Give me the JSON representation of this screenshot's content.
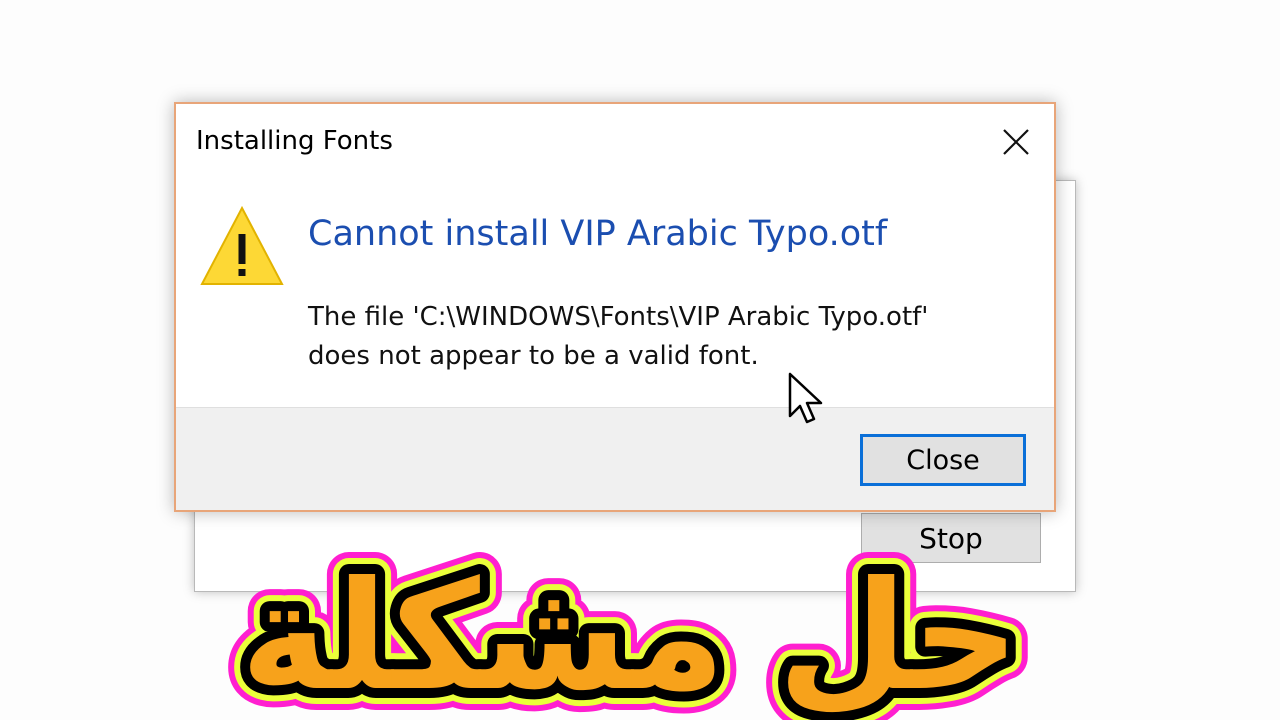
{
  "background_window": {
    "stop_label": "Stop"
  },
  "dialog": {
    "title": "Installing Fonts",
    "headline": "Cannot install VIP Arabic Typo.otf",
    "message_line1": "The file 'C:\\WINDOWS\\Fonts\\VIP Arabic Typo.otf'",
    "message_line2": "does not appear to be a valid font.",
    "close_button_label": "Close",
    "icons": {
      "warning": "warning-icon",
      "close": "close-icon"
    }
  },
  "overlay": {
    "arabic_text": "حل مشكلة",
    "colors": {
      "fill": "#f7a21b",
      "outline": "#000000",
      "glow_inner": "#eaff3a",
      "glow_outer": "#ff1fd0"
    }
  },
  "colors": {
    "headline_blue": "#1b4eb0",
    "button_focus_blue": "#0a6fd8",
    "dialog_border": "#e8a579",
    "warning_yellow": "#fdd835"
  }
}
